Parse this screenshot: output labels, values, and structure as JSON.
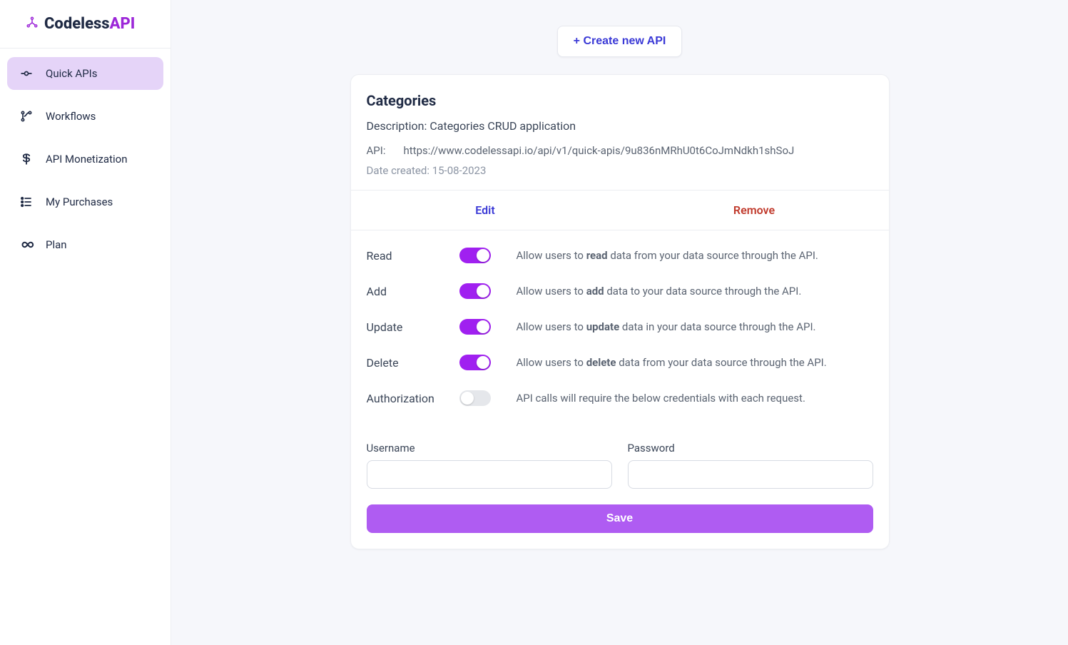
{
  "brand": {
    "name1": "Codeless",
    "name2": "API"
  },
  "sidebar": {
    "items": [
      {
        "label": "Quick APIs"
      },
      {
        "label": "Workflows"
      },
      {
        "label": "API Monetization"
      },
      {
        "label": "My Purchases"
      },
      {
        "label": "Plan"
      }
    ]
  },
  "topbar": {
    "create_label": "+ Create new API"
  },
  "card": {
    "title": "Categories",
    "description_label": "Description:",
    "description_value": "Categories CRUD application",
    "api_label": "API:",
    "api_value": "https://www.codelessapi.io/api/v1/quick-apis/9u836nMRhU0t6CoJmNdkh1shSoJ",
    "date_label": "Date created:",
    "date_value": "15-08-2023",
    "edit_label": "Edit",
    "remove_label": "Remove"
  },
  "permissions": [
    {
      "label": "Read",
      "on": true,
      "desc_pre": "Allow users to ",
      "desc_bold": "read",
      "desc_post": " data from your data source through the API."
    },
    {
      "label": "Add",
      "on": true,
      "desc_pre": "Allow users to ",
      "desc_bold": " add",
      "desc_post": " data to your data source through the API."
    },
    {
      "label": "Update",
      "on": true,
      "desc_pre": "Allow users to ",
      "desc_bold": " update",
      "desc_post": " data in your data source through the API."
    },
    {
      "label": "Delete",
      "on": true,
      "desc_pre": "Allow users to ",
      "desc_bold": " delete",
      "desc_post": " data from your data source through the API."
    },
    {
      "label": "Authorization",
      "on": false,
      "desc_pre": "API calls will require the below credentials with each request.",
      "desc_bold": "",
      "desc_post": ""
    }
  ],
  "credentials": {
    "username_label": "Username",
    "password_label": "Password",
    "username_value": "",
    "password_value": ""
  },
  "save": {
    "label": "Save"
  }
}
